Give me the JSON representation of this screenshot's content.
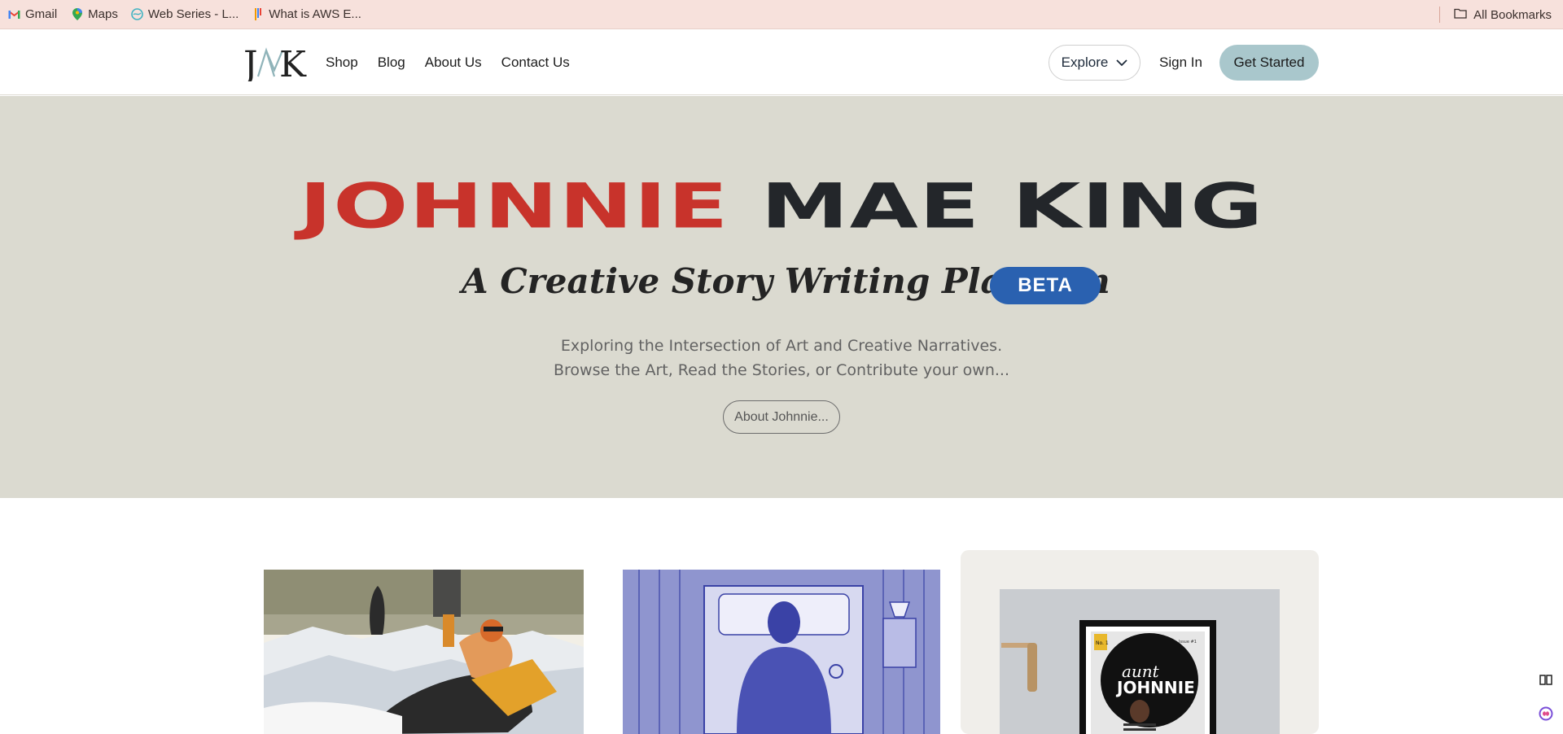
{
  "bookmarks": {
    "items": [
      {
        "label": "Gmail",
        "icon": "gmail-icon"
      },
      {
        "label": "Maps",
        "icon": "maps-pin-icon"
      },
      {
        "label": "Web Series - L...",
        "icon": "globe-icon"
      },
      {
        "label": "What is AWS E...",
        "icon": "bookmark-icon"
      }
    ],
    "all_bookmarks": "All Bookmarks"
  },
  "nav": {
    "logo": "JMK",
    "links": [
      "Shop",
      "Blog",
      "About Us",
      "Contact Us"
    ],
    "explore": "Explore",
    "sign_in": "Sign In",
    "get_started": "Get Started"
  },
  "hero": {
    "title_first": "JOHNNIE",
    "title_rest": "MAE KING",
    "subtitle": "A Creative Story Writing Platform",
    "badge": "BETA",
    "desc_line1": "Exploring the Intersection of Art and Creative Narratives.",
    "desc_line2": "Browse the Art, Read the Stories, or Contribute your own...",
    "about_button": "About Johnnie..."
  },
  "cards": {
    "magazine_issue": "No. 1",
    "magazine_corner": "Issue #1",
    "magazine_title_top": "aunt",
    "magazine_title_main": "JOHNNIE"
  },
  "colors": {
    "hero_bg": "#dbdad0",
    "title_red": "#c8332b",
    "beta_blue": "#2a61b0",
    "get_started_bg": "#a9c7cc",
    "bookmarks_bg": "#f7e1dc"
  }
}
